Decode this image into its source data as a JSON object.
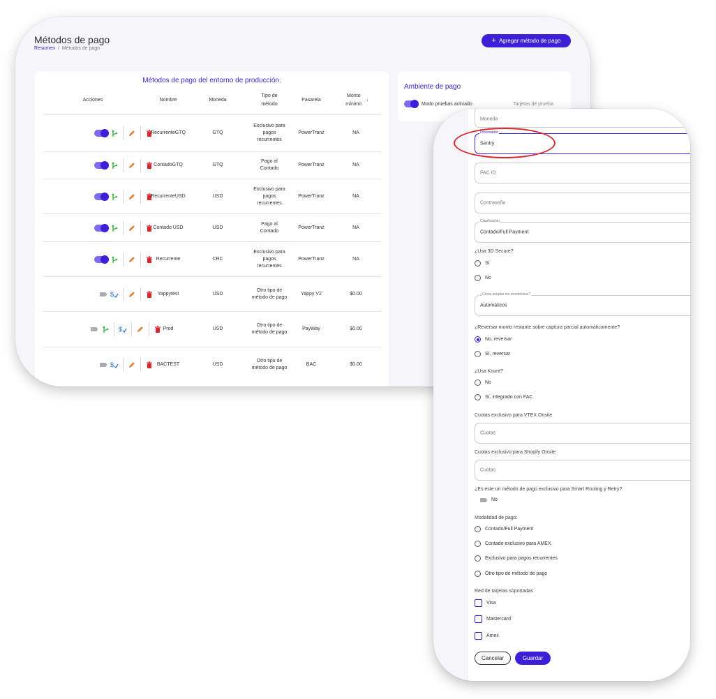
{
  "header": {
    "title": "Métodos de pago",
    "breadcrumb": {
      "home": "Resumen",
      "separator": "/",
      "current": "Métodos de pago"
    },
    "add_button": "Agregar método de pago"
  },
  "table": {
    "caption": "Métodos de pago del entorno de producción.",
    "columns": {
      "actions": "Acciones",
      "name": "Nombre",
      "currency": "Moneda",
      "type": "Tipo de método",
      "gateway": "Pasarela",
      "min_amount": "Monto mínimo"
    },
    "rows": [
      {
        "name": "RecurrenteGTQ",
        "currency": "GTQ",
        "type": "Exclusivo para pagos recurrentes",
        "gateway": "PowerTranz",
        "min": "NA",
        "enabled": true,
        "variant": "standard"
      },
      {
        "name": "ContadoGTQ",
        "currency": "GTQ",
        "type": "Pago al Contado",
        "gateway": "PowerTranz",
        "min": "NA",
        "enabled": true,
        "variant": "standard"
      },
      {
        "name": "RecurrenteUSD",
        "currency": "USD",
        "type": "Exclusivo para pagos recurrentes",
        "gateway": "PowerTranz",
        "min": "NA",
        "enabled": true,
        "variant": "standard"
      },
      {
        "name": "Contado USD",
        "currency": "USD",
        "type": "Pago al Contado",
        "gateway": "PowerTranz",
        "min": "NA",
        "enabled": true,
        "variant": "standard"
      },
      {
        "name": "Recurrente",
        "currency": "CRC",
        "type": "Exclusivo para pagos recurrentes",
        "gateway": "PowerTranz",
        "min": "NA",
        "enabled": true,
        "variant": "standard"
      },
      {
        "name": "Yappytest",
        "currency": "USD",
        "type": "Otro tipo de método de pago",
        "gateway": "Yappy V2",
        "min": "$0.00",
        "enabled": false,
        "variant": "dollar"
      },
      {
        "name": "Prod",
        "currency": "USD",
        "type": "Otro tipo de método de pago",
        "gateway": "PayWay",
        "min": "$0.00",
        "enabled": false,
        "variant": "full"
      },
      {
        "name": "BACTEST",
        "currency": "USD",
        "type": "Otro tipo de método de pago",
        "gateway": "BAC",
        "min": "$0.00",
        "enabled": false,
        "variant": "dollar"
      }
    ]
  },
  "environment": {
    "title": "Ambiente de pago",
    "test_mode_label": "Modo pruebas activado",
    "test_cards_link": "Tarjetas de prueba"
  },
  "form": {
    "currency_placeholder": "Moneda",
    "processor_label": "Procesador",
    "processor_value": "Sentry",
    "fac_id_placeholder": "FAC ID",
    "password_placeholder": "Contraseña",
    "classification_label": "Clasificación",
    "classification_value": "Contado/Full Payment",
    "use_3ds": {
      "question": "¿Usa 3D Secure?",
      "options": [
        "Sí",
        "No"
      ]
    },
    "refunds_label": "¿Cómo aceptar los reembolsos?",
    "refunds_value": "Automáticos",
    "reverse": {
      "question": "¿Reversar monto restante sobre captura parcial automáticamente?",
      "options": [
        "No, reversar",
        "Sí, reversar"
      ]
    },
    "kount": {
      "question": "¿Usa Kount?",
      "options": [
        "No",
        "Sí, integrado con FAC"
      ]
    },
    "vtex": {
      "label": "Cuotas exclusivo para VTEX Onsite",
      "placeholder": "Cuotas"
    },
    "shopify": {
      "label": "Cuotas exclusivo para Shopify Onsite",
      "placeholder": "Cuotas"
    },
    "smart_routing": {
      "question": "¿Es este un método de pago exclusivo para Smart Routing y Retry?",
      "value": "No"
    },
    "modality": {
      "question": "Modalidad de pago:",
      "options": [
        "Contado/Full Payment",
        "Contado exclusivo para AMEX",
        "Exclusivo para pagos recurrentes",
        "Otro tipo de método de pago"
      ]
    },
    "networks": {
      "question": "Red de tarjetas soportadas",
      "options": [
        "Visa",
        "Mastercard",
        "Amex"
      ]
    },
    "cancel_button": "Cancelar",
    "save_button": "Guardar"
  },
  "colors": {
    "primary": "#3d1fd8",
    "edit": "#e07b2e",
    "delete": "#d8282f",
    "branch": "#3bb54a",
    "dollar": "#1f6fd8",
    "highlight": "#d8282f"
  }
}
